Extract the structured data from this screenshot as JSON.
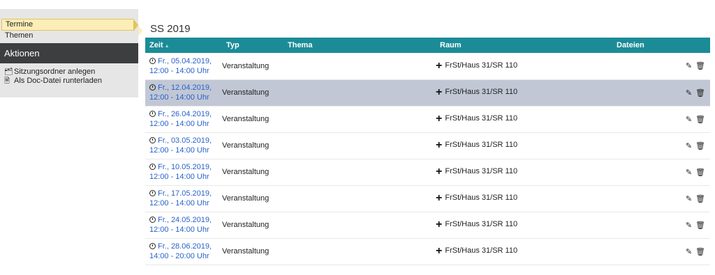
{
  "sidebar": {
    "nav": [
      {
        "label": "Termine",
        "active": true
      },
      {
        "label": "Themen",
        "active": false
      }
    ],
    "actions_title": "Aktionen",
    "actions": [
      {
        "label": "Sitzungsordner anlegen",
        "icon": "folder-icon"
      },
      {
        "label": "Als Doc-Datei runterladen",
        "icon": "document-icon"
      }
    ]
  },
  "main": {
    "semester": "SS 2019",
    "headers": {
      "zeit": "Zeit",
      "typ": "Typ",
      "thema": "Thema",
      "raum": "Raum",
      "dateien": "Dateien"
    },
    "rows": [
      {
        "date": "Fr., 05.04.2019,",
        "time": "12:00 - 14:00 Uhr",
        "typ": "Veranstaltung",
        "thema": "",
        "raum": "FrSt/Haus 31/SR 110",
        "highlight": false
      },
      {
        "date": "Fr., 12.04.2019,",
        "time": "12:00 - 14:00 Uhr",
        "typ": "Veranstaltung",
        "thema": "",
        "raum": "FrSt/Haus 31/SR 110",
        "highlight": true
      },
      {
        "date": "Fr., 26.04.2019,",
        "time": "12:00 - 14:00 Uhr",
        "typ": "Veranstaltung",
        "thema": "",
        "raum": "FrSt/Haus 31/SR 110",
        "highlight": false
      },
      {
        "date": "Fr., 03.05.2019,",
        "time": "12:00 - 14:00 Uhr",
        "typ": "Veranstaltung",
        "thema": "",
        "raum": "FrSt/Haus 31/SR 110",
        "highlight": false
      },
      {
        "date": "Fr., 10.05.2019,",
        "time": "12:00 - 14:00 Uhr",
        "typ": "Veranstaltung",
        "thema": "",
        "raum": "FrSt/Haus 31/SR 110",
        "highlight": false
      },
      {
        "date": "Fr., 17.05.2019,",
        "time": "12:00 - 14:00 Uhr",
        "typ": "Veranstaltung",
        "thema": "",
        "raum": "FrSt/Haus 31/SR 110",
        "highlight": false
      },
      {
        "date": "Fr., 24.05.2019,",
        "time": "12:00 - 14:00 Uhr",
        "typ": "Veranstaltung",
        "thema": "",
        "raum": "FrSt/Haus 31/SR 110",
        "highlight": false
      },
      {
        "date": "Fr., 28.06.2019,",
        "time": "14:00 - 20:00 Uhr",
        "typ": "Veranstaltung",
        "thema": "",
        "raum": "FrSt/Haus 31/SR 110",
        "highlight": false
      }
    ]
  },
  "colors": {
    "header_bg": "#1b8c97",
    "highlight_row": "#c1c7d4",
    "link": "#2962c9",
    "sidebar_dark": "#3d3e40",
    "active_nav": "#fdeeb7"
  }
}
